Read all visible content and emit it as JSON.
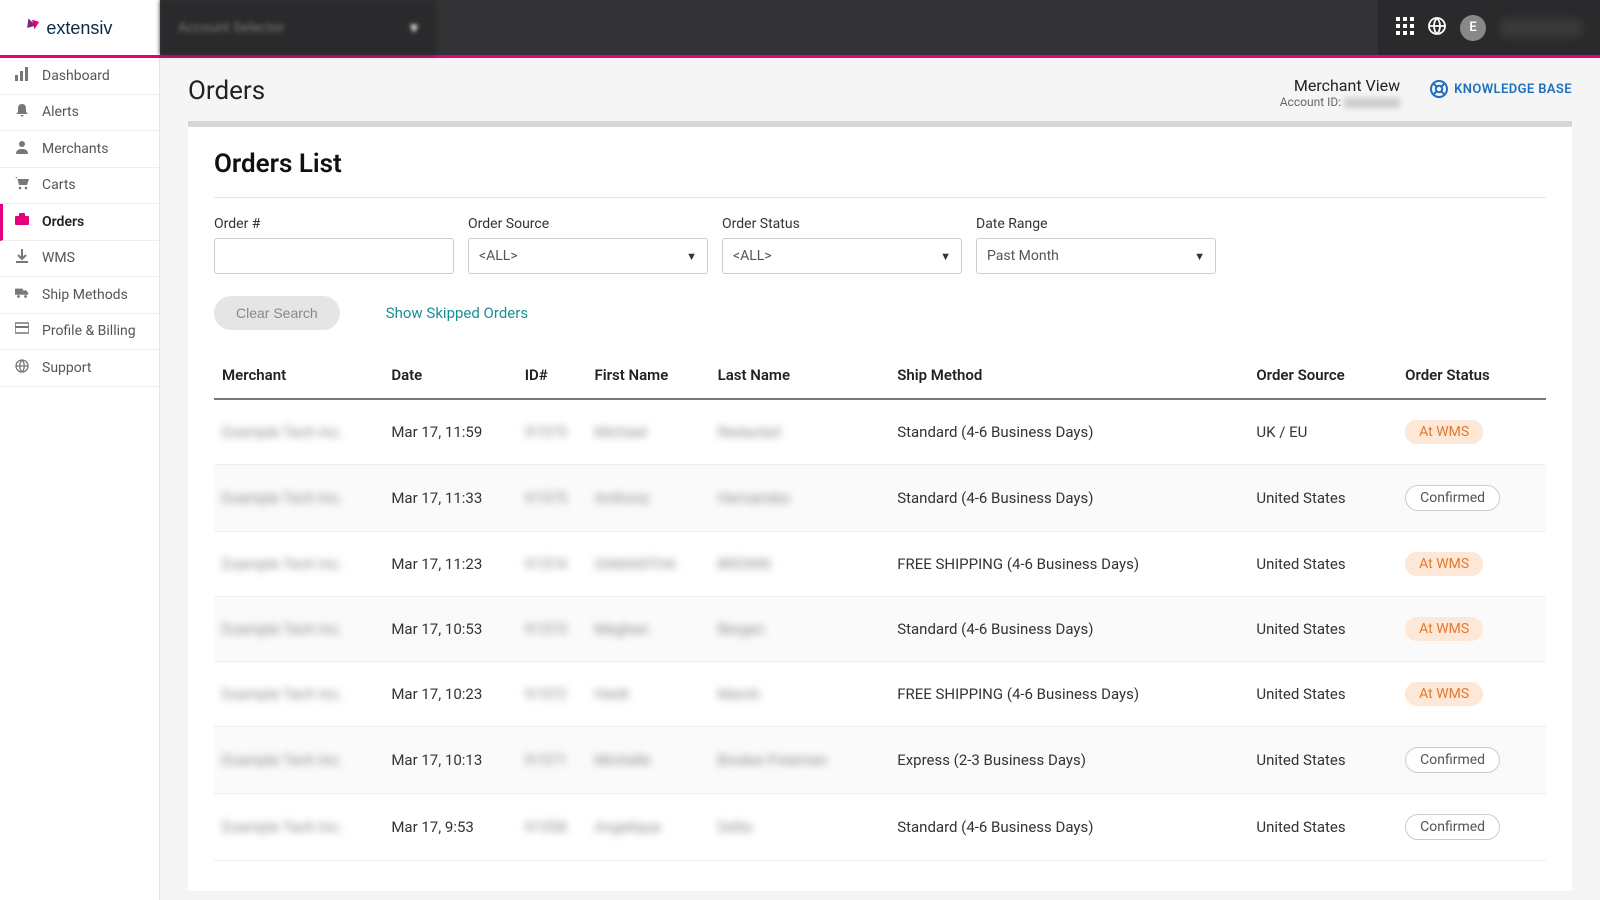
{
  "brand": "extensiv",
  "header": {
    "account_name": "Account Selector",
    "avatar_letter": "E"
  },
  "sidebar": {
    "items": [
      {
        "label": "Dashboard"
      },
      {
        "label": "Alerts"
      },
      {
        "label": "Merchants"
      },
      {
        "label": "Carts"
      },
      {
        "label": "Orders"
      },
      {
        "label": "WMS"
      },
      {
        "label": "Ship Methods"
      },
      {
        "label": "Profile & Billing"
      },
      {
        "label": "Support"
      }
    ],
    "active_index": 4
  },
  "page": {
    "title": "Orders",
    "merchant_view_label": "Merchant View",
    "account_id_label": "Account ID:",
    "knowledge_base": "KNOWLEDGE BASE"
  },
  "panel": {
    "title": "Orders List",
    "filters": {
      "order_number_label": "Order #",
      "order_number_value": "",
      "order_source_label": "Order Source",
      "order_source_value": "<ALL>",
      "order_status_label": "Order Status",
      "order_status_value": "<ALL>",
      "date_range_label": "Date Range",
      "date_range_value": "Past Month"
    },
    "clear_search": "Clear Search",
    "show_skipped": "Show Skipped Orders",
    "columns": {
      "merchant": "Merchant",
      "date": "Date",
      "id": "ID#",
      "first": "First Name",
      "last": "Last Name",
      "ship": "Ship Method",
      "source": "Order Source",
      "status": "Order Status"
    },
    "rows": [
      {
        "merchant": "Example Tech Inc.",
        "date": "Mar 17, 11:59",
        "id": "91575",
        "first": "Michael",
        "last": "Redacted",
        "ship": "Standard (4-6 Business Days)",
        "source": "UK / EU",
        "status": "At WMS",
        "status_class": "atwms"
      },
      {
        "merchant": "Example Tech Inc.",
        "date": "Mar 17, 11:33",
        "id": "91575",
        "first": "Anthony",
        "last": "Hernandez",
        "ship": "Standard (4-6 Business Days)",
        "source": "United States",
        "status": "Confirmed",
        "status_class": "confirmed"
      },
      {
        "merchant": "Example Tech Inc.",
        "date": "Mar 17, 11:23",
        "id": "91574",
        "first": "SAMANTHA",
        "last": "BROWN",
        "ship": "FREE SHIPPING (4-6 Business Days)",
        "source": "United States",
        "status": "At WMS",
        "status_class": "atwms"
      },
      {
        "merchant": "Example Tech Inc.",
        "date": "Mar 17, 10:53",
        "id": "91573",
        "first": "Meghan",
        "last": "Bergen",
        "ship": "Standard (4-6 Business Days)",
        "source": "United States",
        "status": "At WMS",
        "status_class": "atwms"
      },
      {
        "merchant": "Example Tech Inc.",
        "date": "Mar 17, 10:23",
        "id": "91572",
        "first": "Heidi",
        "last": "Marsh",
        "ship": "FREE SHIPPING (4-6 Business Days)",
        "source": "United States",
        "status": "At WMS",
        "status_class": "atwms"
      },
      {
        "merchant": "Example Tech Inc.",
        "date": "Mar 17, 10:13",
        "id": "91571",
        "first": "Michelle",
        "last": "Booker-Freeman",
        "ship": "Express (2-3 Business Days)",
        "source": "United States",
        "status": "Confirmed",
        "status_class": "confirmed"
      },
      {
        "merchant": "Example Tech Inc.",
        "date": "Mar 17, 9:53",
        "id": "91558",
        "first": "Angelique",
        "last": "Delta",
        "ship": "Standard (4-6 Business Days)",
        "source": "United States",
        "status": "Confirmed",
        "status_class": "confirmed"
      }
    ]
  }
}
